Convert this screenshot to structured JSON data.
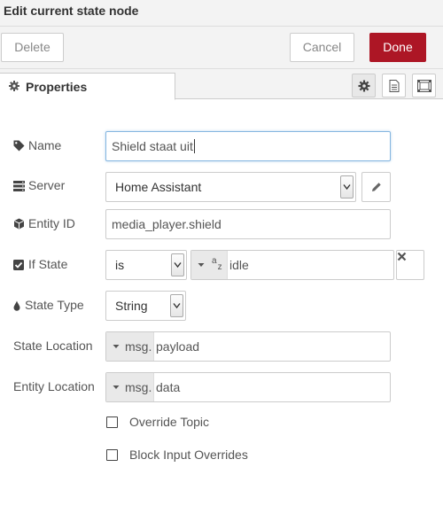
{
  "dialog": {
    "title": "Edit current state node"
  },
  "toolbar": {
    "delete_label": "Delete",
    "cancel_label": "Cancel",
    "done_label": "Done"
  },
  "tabs": {
    "properties_label": "Properties"
  },
  "form": {
    "name_label": "Name",
    "name_value": "Shield staat uit",
    "server_label": "Server",
    "server_value": "Home Assistant",
    "entity_id_label": "Entity ID",
    "entity_id_value": "media_player.shield",
    "if_state_label": "If State",
    "if_state_operator": "is",
    "if_state_type_prefix": "a z",
    "if_state_value": "idle",
    "state_type_label": "State Type",
    "state_type_value": "String",
    "state_location_label": "State Location",
    "state_location_prefix": "msg.",
    "state_location_value": "payload",
    "entity_location_label": "Entity Location",
    "entity_location_prefix": "msg.",
    "entity_location_value": "data",
    "override_topic_label": "Override Topic",
    "block_input_overrides_label": "Block Input Overrides"
  },
  "colors": {
    "done_button": "#ad1625",
    "toolbar_bg": "#f3f3f3"
  },
  "icons": [
    "gear-icon",
    "document-icon",
    "frame-icon",
    "tag-icon",
    "server-icon",
    "cube-icon",
    "checkbox-icon",
    "drop-icon",
    "pencil-icon",
    "times-icon"
  ]
}
